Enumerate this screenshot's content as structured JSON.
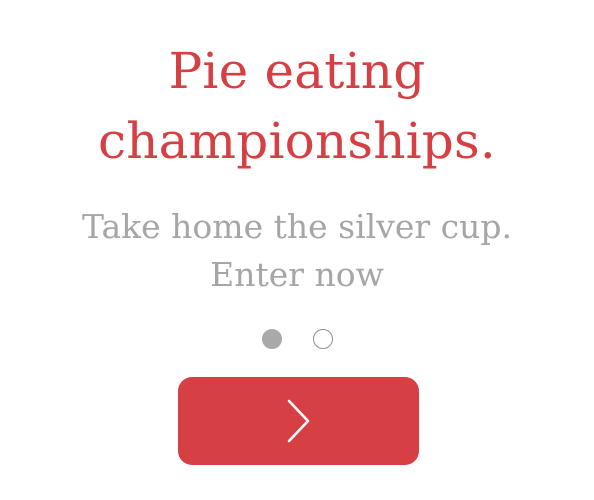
{
  "headline": {
    "line1": "Pie eating",
    "line2": "championships."
  },
  "subheadline": {
    "line1": "Take home the silver cup.",
    "line2": "Enter now"
  },
  "pagination": {
    "current": 1,
    "total": 2
  },
  "next_button": {
    "icon": "chevron-right-icon"
  },
  "colors": {
    "accent": "#d63f43",
    "subtext": "#a6a6a6",
    "dot_active": "#a9a9a9",
    "background": "#ffffff"
  }
}
